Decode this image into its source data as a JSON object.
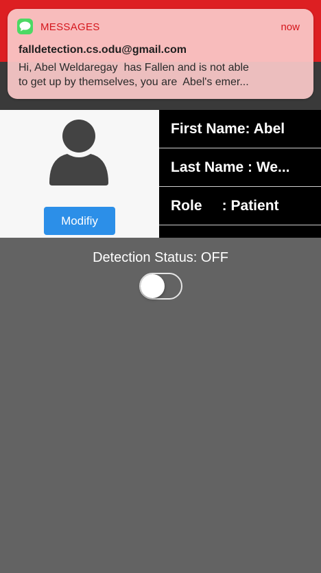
{
  "notification": {
    "app_icon": "messages-bubble-icon",
    "app_name": "MESSAGES",
    "time": "now",
    "sender": "falldetection.cs.odu@gmail.com",
    "body": "Hi, Abel Weldaregay  has Fallen and is not able\nto get up by themselves, you are  Abel's emer..."
  },
  "profile": {
    "avatar_icon": "user-silhouette-icon",
    "modify_label": "Modifiy",
    "first_name_text": "First Name: Abel",
    "last_name_text": "Last Name : We...",
    "role_text": "Role     : Patient"
  },
  "detection": {
    "label": "Detection Status: OFF",
    "enabled": false
  },
  "colors": {
    "notification_accent": "#d5161c",
    "messages_green": "#4cd964",
    "button_blue": "#2c8fe8",
    "background_gray": "#636363"
  }
}
